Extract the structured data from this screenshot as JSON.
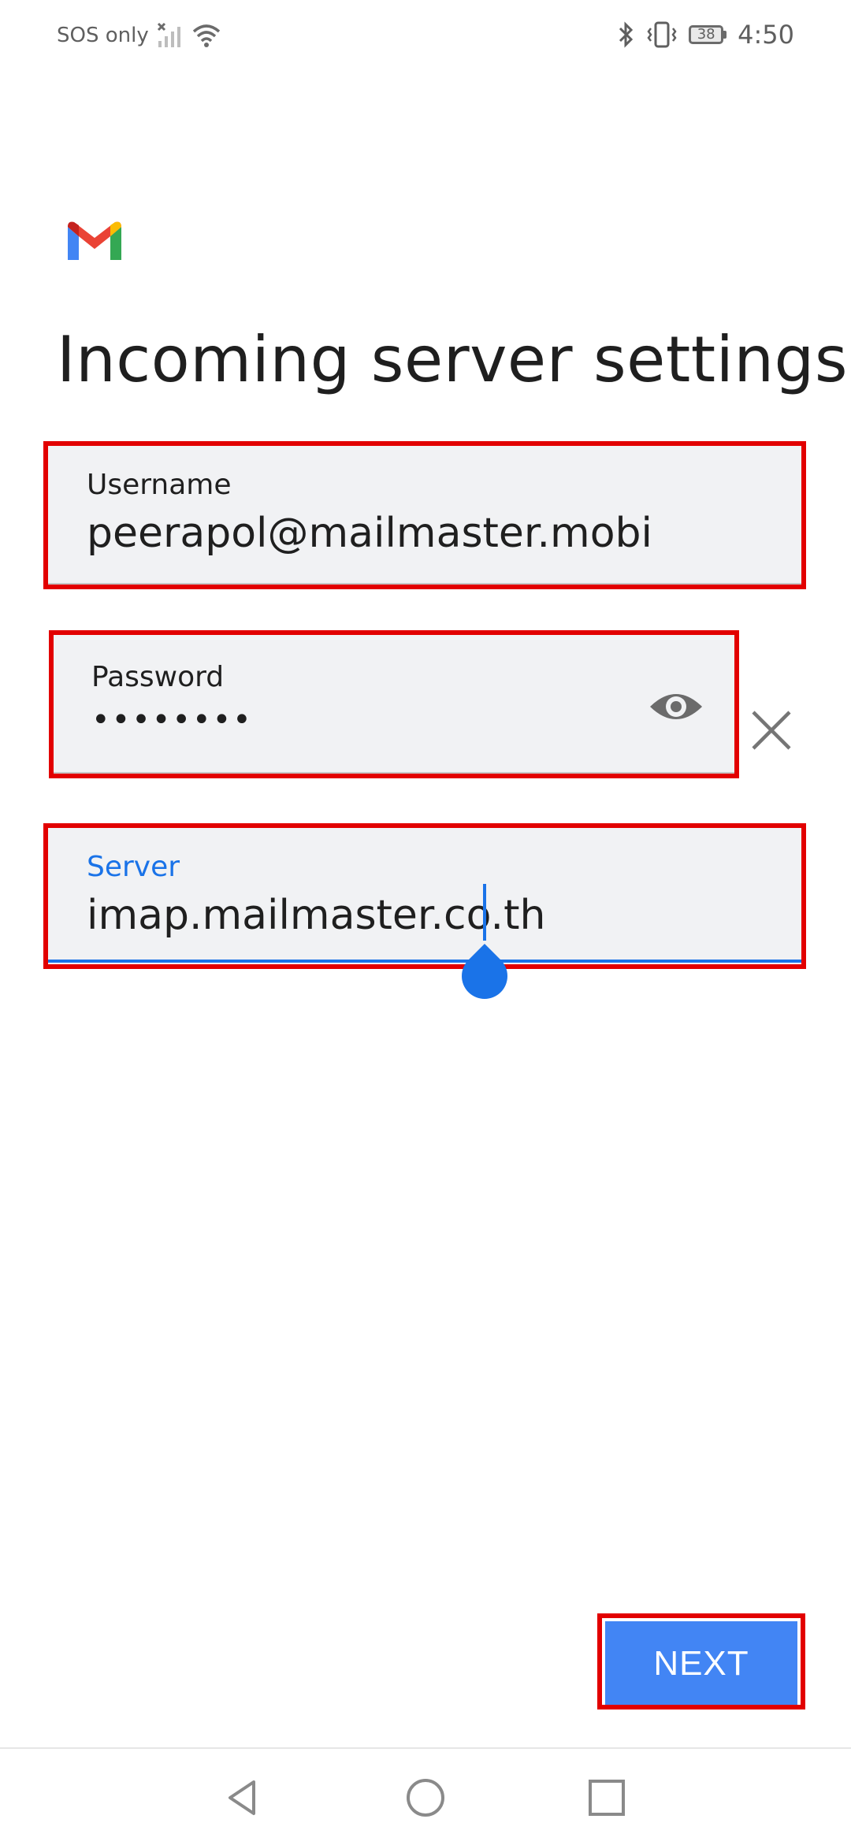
{
  "status_bar": {
    "carrier": "SOS only",
    "battery_level": "38",
    "time": "4:50",
    "icons": [
      "signal-icon",
      "wifi-icon",
      "bluetooth-icon",
      "vibrate-icon",
      "battery-icon"
    ]
  },
  "app": {
    "logo": "gmail-logo",
    "title": "Incoming server settings"
  },
  "form": {
    "username": {
      "label": "Username",
      "value": "peerapol@mailmaster.mobi"
    },
    "password": {
      "label": "Password",
      "value": "••••••••",
      "reveal_icon": "eye-icon",
      "clear_icon": "close-icon"
    },
    "server": {
      "label": "Server",
      "value": "imap.mailmaster.co.th"
    }
  },
  "actions": {
    "next_label": "NEXT"
  },
  "nav_bar": {
    "icons": [
      "back-icon",
      "home-icon",
      "recents-icon"
    ]
  },
  "colors": {
    "accent": "#1a73e8",
    "button": "#4285f4",
    "highlight": "#e20000",
    "field_bg": "#f1f2f4"
  }
}
